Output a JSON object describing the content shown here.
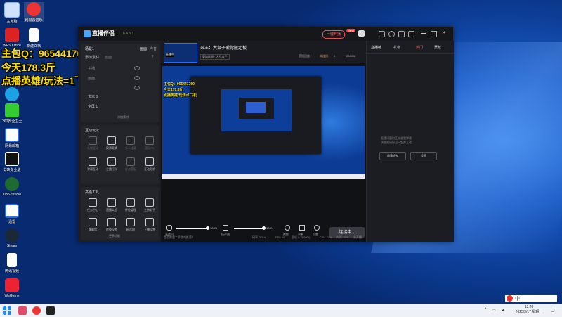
{
  "desktop": {
    "icons": [
      {
        "label": "主电脑"
      },
      {
        "label": "网易云音乐"
      },
      {
        "label": "WPS Office"
      },
      {
        "label": "新建文档"
      },
      {
        "label": "QQ"
      },
      {
        "label": "360安全卫士"
      },
      {
        "label": "网易邮箱"
      },
      {
        "label": "剪映专业版"
      },
      {
        "label": "OBS Studio"
      },
      {
        "label": "迅雷"
      },
      {
        "label": "Steam"
      },
      {
        "label": "腾讯视频"
      },
      {
        "label": "WeGame"
      }
    ],
    "overlay_lines": [
      "主包Q：965441769",
      "今天178.3斤",
      "点播英雄/玩法=1飞机"
    ]
  },
  "app": {
    "name": "直播伴侣",
    "version": "6.4.5.1",
    "header_btn": "一键开播",
    "header_badge": "NEW",
    "left": {
      "scene_label": "场景1",
      "tabs": [
        "画面",
        "声音"
      ],
      "sources_header": [
        "添加素材",
        "画面"
      ],
      "scenes": [
        "主播",
        "画面",
        "文本 3",
        "全屏 1"
      ],
      "add_source": "添加素材",
      "interact_title": "互动玩法",
      "interact_tools": [
        {
          "label": "礼物互动",
          "dim": true
        },
        {
          "label": "投票竞猜",
          "dim": false
        },
        {
          "label": "多人连麦",
          "dim": true
        },
        {
          "label": "团队PK",
          "dim": true
        },
        {
          "label": "弹幕互动",
          "dim": false
        },
        {
          "label": "主播打卡",
          "dim": false
        },
        {
          "label": "任务面板",
          "dim": true
        },
        {
          "label": "互动贴纸",
          "dim": false
        }
      ],
      "advanced_title": "高级工具",
      "advanced_tools": [
        {
          "label": "任务中心"
        },
        {
          "label": "直播实验"
        },
        {
          "label": "评论管理"
        },
        {
          "label": "主持助手"
        },
        {
          "label": "弹幕墙"
        },
        {
          "label": "房管设置"
        },
        {
          "label": "粉丝团"
        },
        {
          "label": "下播设置"
        }
      ],
      "more": "更多功能"
    },
    "stream": {
      "title": "亲王：大鼠子爱你限定板",
      "category": "英雄联盟 · 大乱斗子",
      "btn_record": "直播回放",
      "btn_status": "未连线",
      "likes": "0",
      "viewers": "234306",
      "thumb_text": "直播中"
    },
    "preview_overlay": [
      "主包Q：965441769",
      "今天178.3斤",
      "点播英雄/玩法=1飞机"
    ],
    "controls": {
      "mic_label": "麦克风",
      "mic_value": "100%",
      "speaker_label": "扬声器",
      "speaker_value": "100%",
      "buttons": [
        "美颜",
        "录制",
        "设置"
      ],
      "connect": "连接中..."
    },
    "right": {
      "tabs": [
        "直播榜",
        "礼物",
        "热门",
        "贡献"
      ],
      "msg_line1": "直播间暂时还未收到弹幕",
      "msg_line2": "快去邀请好友一起来互动",
      "btn_left": "邀请好友",
      "btn_right": "设置"
    },
    "statusbar": {
      "hint": "是否需要二手游戏推荐？",
      "items": [
        "码率 0Kb/s",
        "FPS 60",
        "丢帧 0 (0.00%)",
        "CPU 23%",
        "内存 16%",
        "未开播"
      ]
    }
  },
  "taskbar": {
    "time": "13:20",
    "date": "2025/3/17 星期一",
    "ime": "中"
  }
}
